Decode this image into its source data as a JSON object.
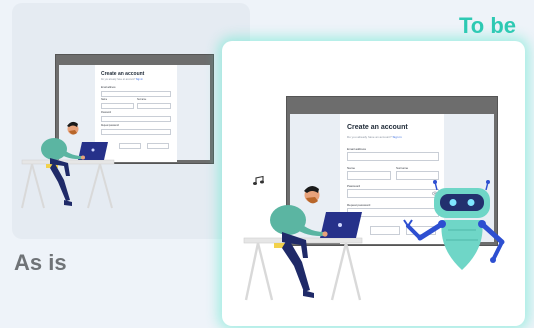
{
  "labels": {
    "as_is": "As is",
    "to_be": "To be"
  },
  "form": {
    "title": "Create an account",
    "subtitle": "Do you already have an account?",
    "signin_link": "Sign in",
    "fields": {
      "email": "Email address",
      "name": "Name",
      "surname": "Surname",
      "password": "Password",
      "repeat": "Repeat password"
    }
  },
  "colors": {
    "accent": "#2ec9b3",
    "label_gray": "#6f7377",
    "shirt": "#5bb5a2",
    "pants": "#1f2a68",
    "hair": "#b8662a",
    "robot_blue": "#2d4fd1",
    "robot_body": "#6fd6c7"
  },
  "icons": [
    "music-note-icon",
    "eye-icon"
  ]
}
